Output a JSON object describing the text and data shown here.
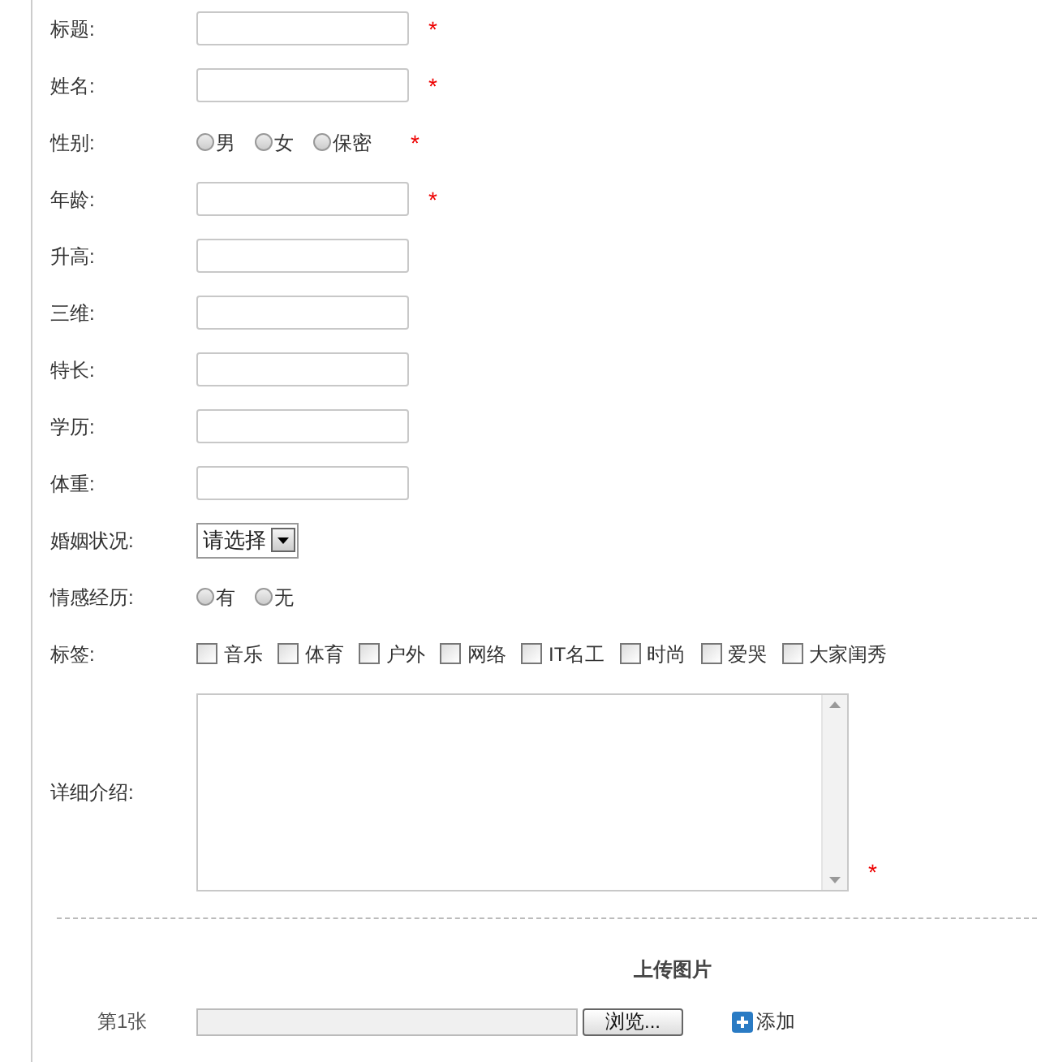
{
  "fields": [
    {
      "kind": "text",
      "label": "标题:",
      "required": true
    },
    {
      "kind": "text",
      "label": "姓名:",
      "required": true
    },
    {
      "kind": "radio",
      "label": "性别:",
      "required": true,
      "options": [
        {
          "label": "男",
          "selected": false
        },
        {
          "label": "女",
          "selected": false
        },
        {
          "label": "保密",
          "selected": false
        }
      ]
    },
    {
      "kind": "text",
      "label": "年龄:",
      "required": true
    },
    {
      "kind": "text",
      "label": "升高:",
      "required": false
    },
    {
      "kind": "text",
      "label": "三维:",
      "required": false
    },
    {
      "kind": "text",
      "label": "特长:",
      "required": false
    },
    {
      "kind": "text",
      "label": "学历:",
      "required": false
    },
    {
      "kind": "text",
      "label": "体重:",
      "required": false
    },
    {
      "kind": "select",
      "label": "婚姻状况:",
      "required": false,
      "value": "请选择"
    },
    {
      "kind": "radio",
      "label": "情感经历:",
      "required": false,
      "options": [
        {
          "label": "有",
          "selected": false
        },
        {
          "label": "无",
          "selected": false
        }
      ]
    },
    {
      "kind": "checkbox",
      "label": "标签:",
      "required": false,
      "options": [
        {
          "label": "音乐",
          "checked": false
        },
        {
          "label": "体育",
          "checked": false
        },
        {
          "label": "户外",
          "checked": false
        },
        {
          "label": "网络",
          "checked": false
        },
        {
          "label": "IT名工",
          "checked": false
        },
        {
          "label": "时尚",
          "checked": false
        },
        {
          "label": "爱哭",
          "checked": false
        },
        {
          "label": "大家闺秀",
          "checked": false
        }
      ]
    },
    {
      "kind": "textarea",
      "label": "详细介绍:",
      "required": true
    }
  ],
  "required_mark": "*",
  "upload": {
    "title": "上传图片",
    "row_label": "第1张",
    "browse_button": "浏览...",
    "add_link": "添加"
  }
}
